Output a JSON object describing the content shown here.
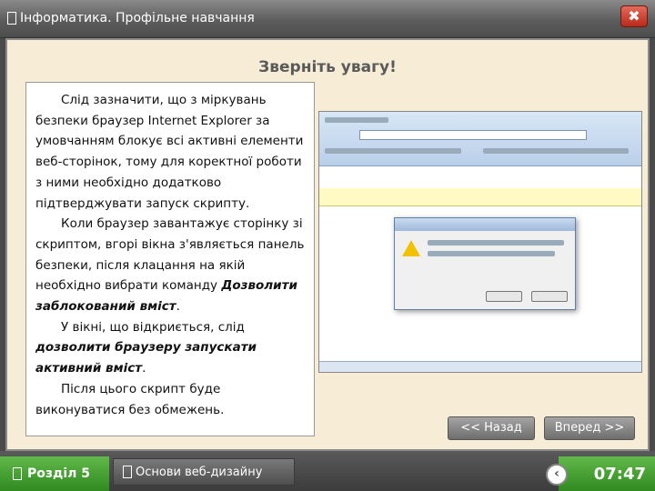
{
  "window": {
    "title": "Інформатика. Профільне навчання",
    "close_label": "✖"
  },
  "slide": {
    "heading": "Зверніть увагу!",
    "paragraph1": "Слід зазначити, що з міркувань безпеки браузер Internet Explorer за умовчанням блокує всі активні елементи веб-сторінок, тому для коректної роботи з ними необхідно додатково підтверджувати запуск скрипту.",
    "paragraph2_before": "Коли браузер завантажує сторінку зі скриптом, вгорі вікна з'являється панель безпеки, після клацання на якій необхідно вибрати команду ",
    "paragraph2_command": "Дозволити заблокований вміст",
    "paragraph2_after": ".",
    "paragraph3_before": "У вікні, що відкриється, слід ",
    "paragraph3_command": "дозволити браузеру запускати активний вміст",
    "paragraph3_after": ".",
    "paragraph4": "Після цього скрипт буде виконуватися без обмежень."
  },
  "navigation": {
    "back_label": "<< Назад",
    "forward_label": "Вперед >>"
  },
  "footer": {
    "section_label": "Розділ 5",
    "topic_label": "Основи веб-дизайну",
    "time": "07:47"
  }
}
